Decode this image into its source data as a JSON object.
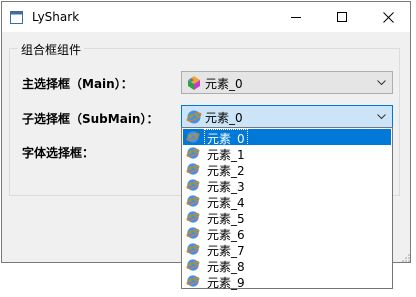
{
  "window": {
    "title": "LyShark"
  },
  "group": {
    "title": "组合框组件"
  },
  "labels": {
    "main": "主选择框（Main）：",
    "sub": "子选择框（SubMain）：",
    "font": "字体选择框："
  },
  "main_combo": {
    "value": "元素_0",
    "icon": "colorful-blocks-icon"
  },
  "sub_combo": {
    "value": "元素_0",
    "icon": "globe-icon"
  },
  "dropdown": {
    "items": [
      "元素_0",
      "元素_1",
      "元素_2",
      "元素_3",
      "元素_4",
      "元素_5",
      "元素_6",
      "元素_7",
      "元素_8",
      "元素_9"
    ],
    "selected_index": 0,
    "item_icon": "globe-icon"
  },
  "colors": {
    "accent": "#0078d7",
    "hover": "#cce4f7"
  }
}
